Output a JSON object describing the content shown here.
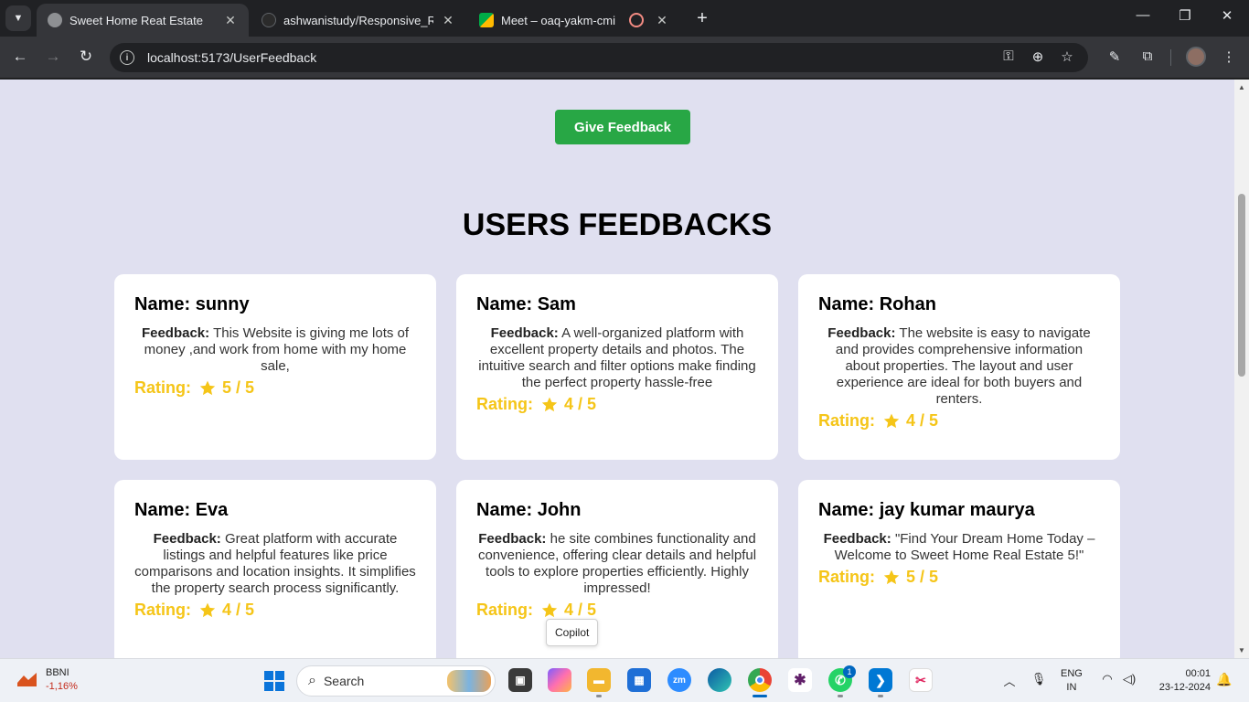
{
  "browser": {
    "tabs": [
      {
        "title": "Sweet Home Reat Estate",
        "active": true
      },
      {
        "title": "ashwanistudy/Responsive_Rider",
        "active": false
      },
      {
        "title": "Meet – oaq-yakm-cmi",
        "active": false
      }
    ],
    "url": "localhost:5173/UserFeedback"
  },
  "page": {
    "give_feedback_label": "Give Feedback",
    "section_title": "USERS FEEDBACKS",
    "feedback_label": "Feedback:",
    "rating_label": "Rating:",
    "cards": [
      {
        "name": "Name: sunny",
        "feedback": "This Website is giving me lots of money ,and work from home with my home sale,",
        "rating": "5 / 5"
      },
      {
        "name": "Name: Sam",
        "feedback": "A well-organized platform with excellent property details and photos. The intuitive search and filter options make finding the perfect property hassle-free",
        "rating": "4 / 5"
      },
      {
        "name": "Name: Rohan",
        "feedback": "The website is easy to navigate and provides comprehensive information about properties. The layout and user experience are ideal for both buyers and renters.",
        "rating": "4 / 5"
      },
      {
        "name": "Name: Eva",
        "feedback": "Great platform with accurate listings and helpful features like price comparisons and location insights. It simplifies the property search process significantly.",
        "rating": "4 / 5"
      },
      {
        "name": "Name: John",
        "feedback": "he site combines functionality and convenience, offering clear details and helpful tools to explore properties efficiently. Highly impressed!",
        "rating": "4 / 5"
      },
      {
        "name": "Name: jay kumar maurya",
        "feedback": "\"Find Your Dream Home Today – Welcome to Sweet Home Real Estate 5!\"",
        "rating": "5 / 5"
      }
    ],
    "tooltip": "Copilot"
  },
  "taskbar": {
    "stock_symbol": "BBNI",
    "stock_change": "-1,16%",
    "search_label": "Search",
    "whatsapp_badge": "1",
    "lang_line1": "ENG",
    "lang_line2": "IN",
    "time": "00:01",
    "date": "23-12-2024"
  },
  "colors": {
    "page_background": "#e0e0f0",
    "button_green": "#28a745",
    "rating_yellow": "#f5c518",
    "card_white": "#ffffff"
  }
}
